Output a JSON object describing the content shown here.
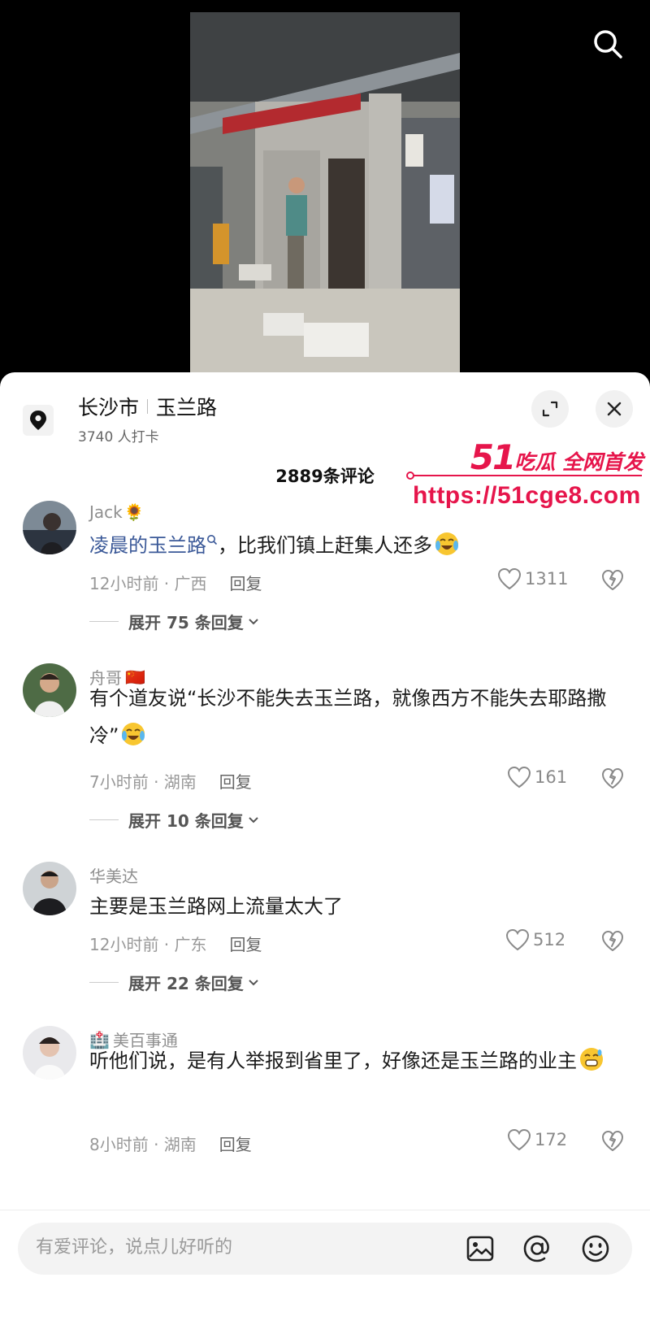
{
  "location": {
    "city": "长沙市",
    "road": "玉兰路",
    "checkins": "3740 人打卡"
  },
  "comments_header": "2889条评论",
  "watermark": {
    "number": "51",
    "brand": "吃瓜 全网首发",
    "url": "https://51cge8.com"
  },
  "comments": [
    {
      "user": "Jack",
      "user_badge": "🌻",
      "text_link": "凌晨的玉兰路",
      "text": "，比我们镇上赶集人还多",
      "time_region": "12小时前 · 广西",
      "reply_label": "回复",
      "likes": "1311",
      "expand": "展开 75 条回复"
    },
    {
      "user": "舟哥",
      "user_badge": "🇨🇳",
      "text": "有个道友说“长沙不能失去玉兰路，就像西方不能失去耶路撒冷”",
      "time_region": "7小时前 · 湖南",
      "reply_label": "回复",
      "likes": "161",
      "expand": "展开 10 条回复"
    },
    {
      "user": "华美达",
      "text": "主要是玉兰路网上流量太大了",
      "time_region": "12小时前 · 广东",
      "reply_label": "回复",
      "likes": "512",
      "expand": "展开 22 条回复"
    },
    {
      "user": "美百事通",
      "user_badge": "🏥",
      "text": "听他们说，是有人举报到省里了，好像还是玉兰路的业主",
      "time_region": "8小时前 · 湖南",
      "reply_label": "回复",
      "likes": "172"
    }
  ],
  "input": {
    "placeholder": "有爱评论，说点儿好听的"
  },
  "colors": {
    "watermark": "#e6154b",
    "link": "#3b5998"
  },
  "icons": [
    "search-icon",
    "location-pin-icon",
    "expand-icon",
    "close-icon",
    "heart-icon",
    "dislike-heart-icon",
    "image-icon",
    "at-icon",
    "emoji-icon"
  ]
}
